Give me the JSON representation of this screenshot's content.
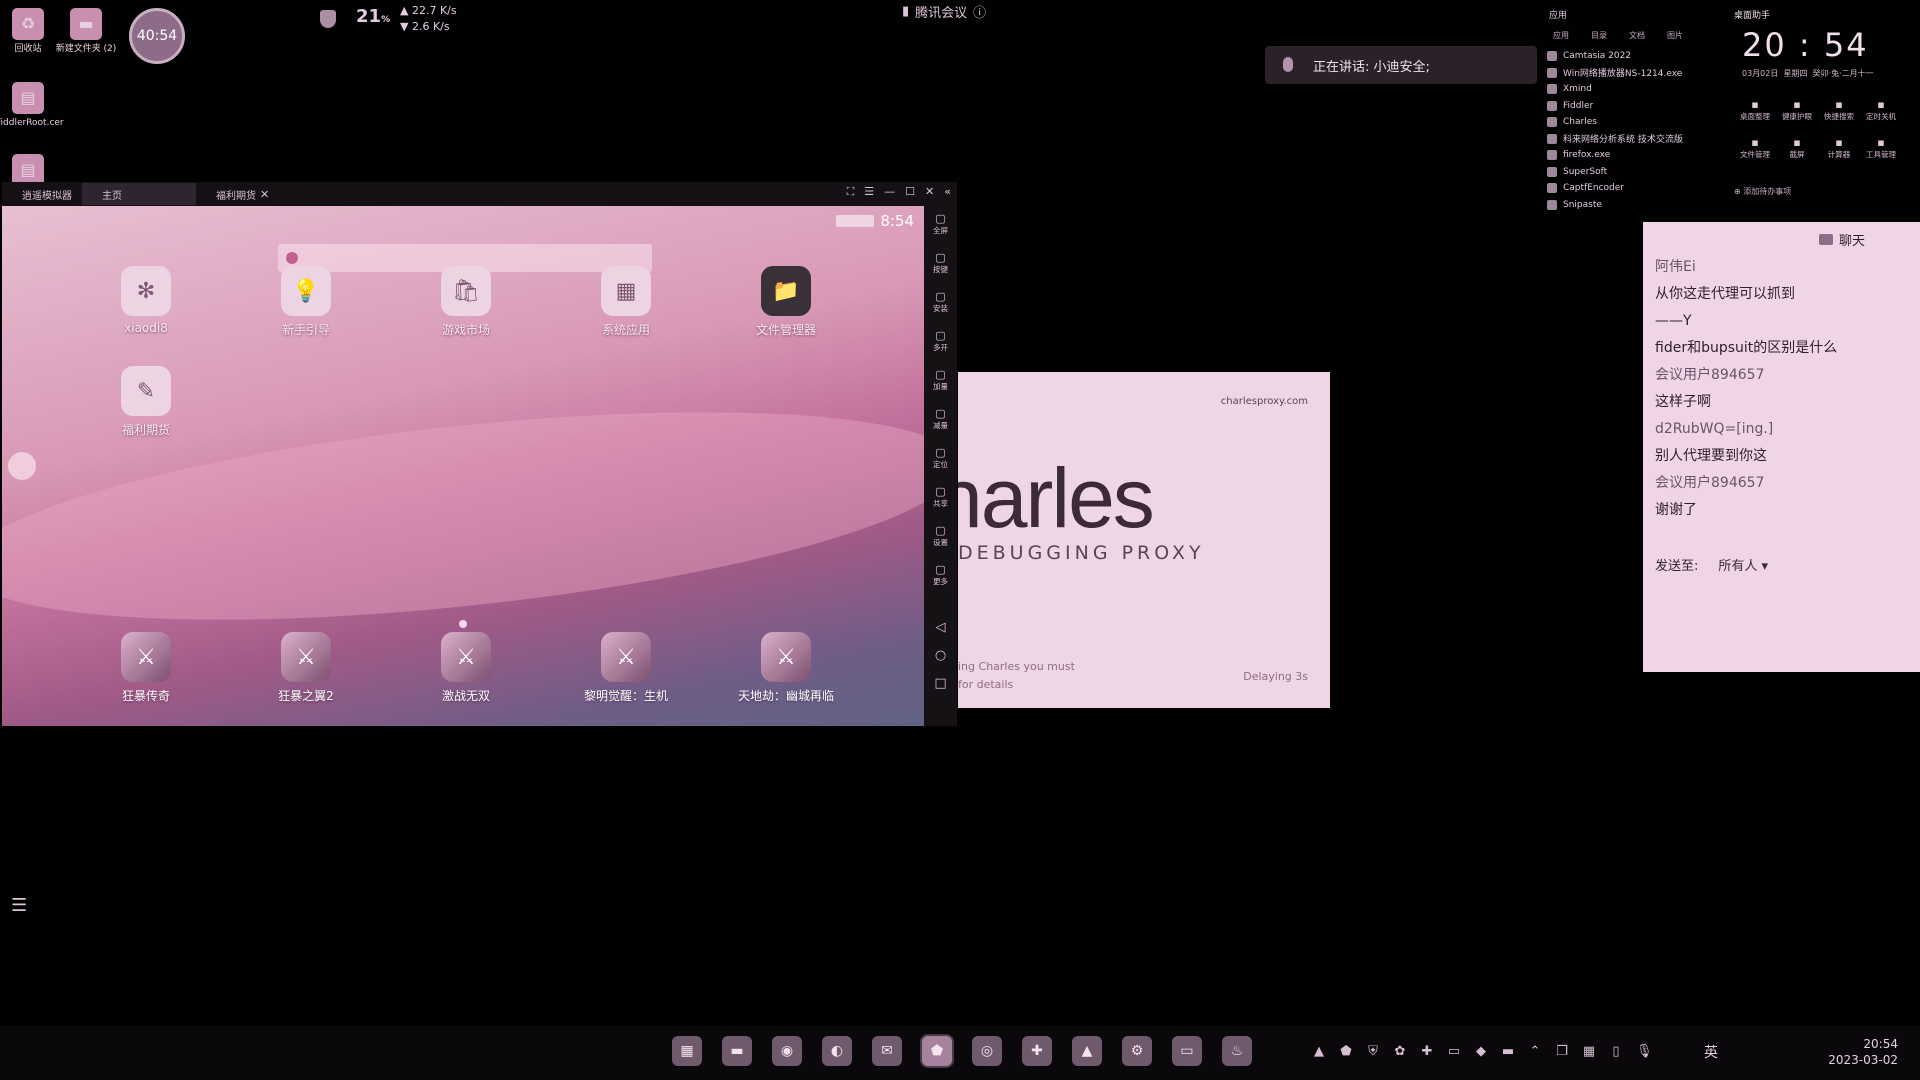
{
  "desktop": {
    "icons": [
      {
        "label": "回收站"
      },
      {
        "label": "新建文件夹 (2)"
      },
      {
        "label": "FiddlerRoot.cer"
      }
    ],
    "timer": "40:54"
  },
  "netmon": {
    "cpu_pct": "21",
    "pct_unit": "%",
    "up": "22.7 K/s",
    "down": "2.6 K/s"
  },
  "meeting": {
    "title": "腾讯会议",
    "speaking": "正在讲话: 小迪安全;"
  },
  "app_panel": {
    "header": "应用",
    "tabs": [
      "应用",
      "目录",
      "文档",
      "图片"
    ],
    "items": [
      "Camtasia 2022",
      "Win网络播放器NS-1214.exe",
      "Xmind",
      "Fiddler",
      "Charles",
      "科来网络分析系统 技术交流版",
      "firefox.exe",
      "SuperSoft",
      "CaptfEncoder",
      "Snipaste"
    ]
  },
  "clock_panel": {
    "label": "桌面助手",
    "time": "20 : 54",
    "date": "03月02日",
    "weekday": "星期四",
    "lunar": "癸卯·兔·二月十一",
    "tools": [
      "桌面整理",
      "健康护眼",
      "快捷搜索",
      "定时关机",
      "文件管理",
      "截屏",
      "计算器",
      "工具管理"
    ],
    "todo": "添加待办事项"
  },
  "emulator": {
    "app_name": "逍遥模拟器",
    "tab_home": "主页",
    "tab_2": "福利期货",
    "android_time": "8:54",
    "apps": [
      {
        "label": "xiaodi8",
        "icon": "✻"
      },
      {
        "label": "新手引导",
        "icon": "💡"
      },
      {
        "label": "游戏市场",
        "icon": "🛍"
      },
      {
        "label": "系统应用",
        "icon": "▦"
      },
      {
        "label": "文件管理器",
        "icon": "📁"
      },
      {
        "label": "福利期货",
        "icon": "✎"
      }
    ],
    "dock": [
      {
        "label": "狂暴传奇"
      },
      {
        "label": "狂暴之翼2"
      },
      {
        "label": "激战无双"
      },
      {
        "label": "黎明觉醒：生机"
      },
      {
        "label": "天地劫：幽城再临"
      }
    ],
    "sidebar": [
      "全屏",
      "按键",
      "安装",
      "多开",
      "加量",
      "减量",
      "定位",
      "共享",
      "设置",
      "更多"
    ]
  },
  "charles": {
    "url": "charlesproxy.com",
    "logo": "harles",
    "subtitle": "DEBUGGING PROXY",
    "note1": "ing Charles you must",
    "note2": "for details",
    "delay": "Delaying 3s"
  },
  "chat": {
    "title": "聊天",
    "messages": [
      {
        "text": "阿伟Ei",
        "sender": true
      },
      {
        "text": "从你这走代理可以抓到",
        "sender": false
      },
      {
        "text": "——Y",
        "sender": false
      },
      {
        "text": "fider和bupsuit的区别是什么",
        "sender": false
      },
      {
        "text": "会议用户894657",
        "sender": true
      },
      {
        "text": "这样子啊",
        "sender": false
      },
      {
        "text": "d2RubWQ=[ing.]",
        "sender": true
      },
      {
        "text": "别人代理要到你这",
        "sender": false
      },
      {
        "text": "会议用户894657",
        "sender": true
      },
      {
        "text": "谢谢了",
        "sender": false
      }
    ],
    "send_to_label": "发送至:",
    "send_to_value": "所有人 ▾"
  },
  "taskbar": {
    "lang": "英",
    "time": "20:54",
    "date": "2023-03-02"
  }
}
